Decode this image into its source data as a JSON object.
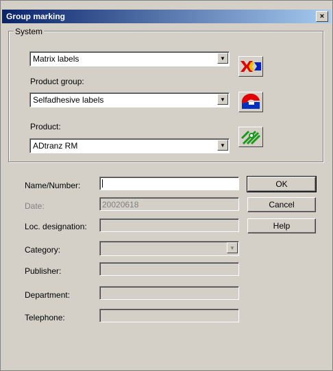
{
  "window": {
    "title": "Group marking",
    "close_glyph": "×"
  },
  "system_group": {
    "legend": "System",
    "system_value": "Matrix labels",
    "product_group_label": "Product group:",
    "product_group_value": "Selfadhesive labels",
    "product_label": "Product:",
    "product_value": "ADtranz RM"
  },
  "icons": {
    "system_icon": "matrix-labels-icon",
    "product_group_icon": "selfadhesive-labels-icon",
    "product_icon": "product-icon"
  },
  "form": {
    "name_label": "Name/Number:",
    "name_value": "",
    "date_label": "Date:",
    "date_value": "20020618",
    "loc_label": "Loc. designation:",
    "loc_value": "",
    "category_label": "Category:",
    "category_value": "",
    "publisher_label": "Publisher:",
    "publisher_value": "",
    "department_label": "Department:",
    "department_value": "",
    "telephone_label": "Telephone:",
    "telephone_value": ""
  },
  "buttons": {
    "ok": "OK",
    "cancel": "Cancel",
    "help": "Help"
  }
}
